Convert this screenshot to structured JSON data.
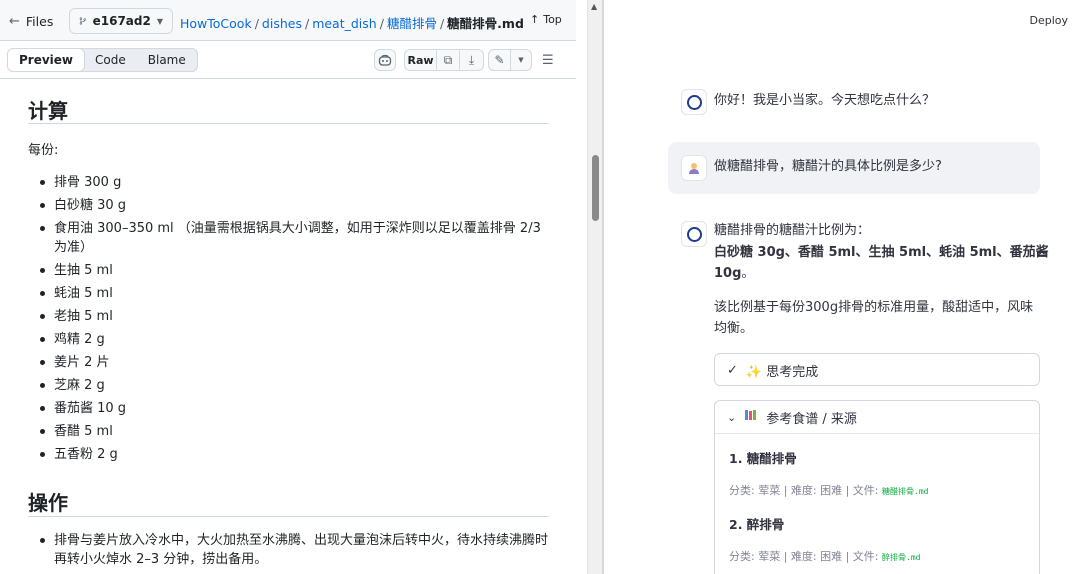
{
  "github": {
    "files_label": "Files",
    "branch": "e167ad2",
    "breadcrumb": [
      "HowToCook",
      "dishes",
      "meat_dish",
      "糖醋排骨",
      "糖醋排骨.md"
    ],
    "top_label": "Top",
    "view_tabs": [
      "Preview",
      "Code",
      "Blame"
    ],
    "raw_label": "Raw"
  },
  "document": {
    "section_calc": "计算",
    "per_serving": "每份:",
    "ingredients": [
      "排骨 300 g",
      "白砂糖 30 g",
      "食用油 300–350 ml （油量需根据锅具大小调整，如用于深炸则以足以覆盖排骨 2/3 为准）",
      "生抽 5 ml",
      "蚝油 5 ml",
      "老抽 5 ml",
      "鸡精 2 g",
      "姜片 2 片",
      "芝麻 2 g",
      "番茄酱 10 g",
      "香醋 5 ml",
      "五香粉 2 g"
    ],
    "section_steps": "操作",
    "steps": [
      "排骨与姜片放入冷水中，大火加热至水沸腾、出现大量泡沫后转中火，待水持续沸腾时再转小火焯水 2–3 分钟，捞出备用。"
    ]
  },
  "chat": {
    "deploy_label": "Deploy",
    "greeting": "你好！我是小当家。今天想吃点什么？",
    "user_question": "做糖醋排骨，糖醋汁的具体比例是多少?",
    "answer_intro": "糖醋排骨的糖醋汁比例为：",
    "answer_ratio_line1": "白砂糖 30g、香醋 5ml、生抽 5ml、蚝油 5ml、番茄酱",
    "answer_ratio_line2": "10g",
    "answer_ratio_end": "。",
    "answer_note": "该比例基于每份300g排骨的标准用量，酸甜适中，风味均衡。",
    "thinking_label": "✨ 思考完成",
    "sources_label": "参考食谱 / 来源",
    "sources": [
      {
        "title": "1. 糖醋排骨",
        "meta": "分类: 荤菜 | 难度: 困难 | 文件: ",
        "file": "糖醋排骨.md"
      },
      {
        "title": "2. 醉排骨",
        "meta": "分类: 荤菜 | 难度: 困难 | 文件: ",
        "file": "醉排骨.md"
      }
    ]
  }
}
